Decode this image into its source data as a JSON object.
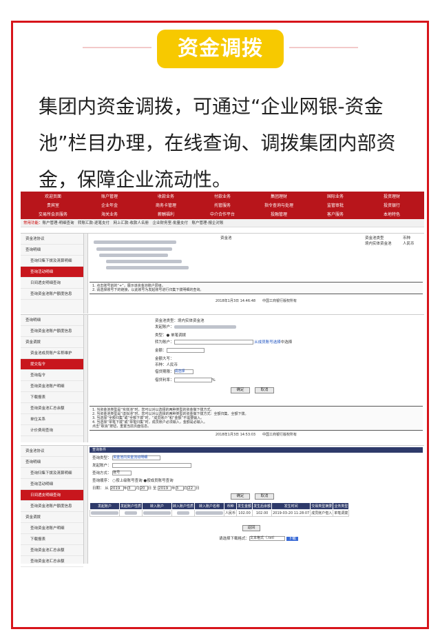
{
  "header": {
    "badge": "资金调拨",
    "intro": "集团内资金调拨，可通过“企业网银-资金池”栏目办理，在线查询、调拨集团内部资金，保障企业流动性。"
  },
  "nav": {
    "items": [
      "欢迎页面",
      "账户管理",
      "收款业务",
      "付款业务",
      "集团理财",
      "国际业务",
      "投资理财",
      "贵宾室",
      "企业年金",
      "商务卡管理",
      "托管服务",
      "指令查询与处理",
      "监管审批",
      "投资银行",
      "交易所会员服务",
      "海关业务",
      "薪酬福利",
      "中介合作平台",
      "投融管理",
      "客户服务",
      "本地特色"
    ]
  },
  "quickbar": {
    "label": "常用功能：",
    "items": "账户管理-明细查询　转账汇款-逐笔支付　网上汇款-收款人名册　企业财务室-批量支付　账户管理-报企对账"
  },
  "panel1": {
    "side": [
      "资金池协议",
      "查询明细",
      "查询归集下拨及清算明细",
      "查询活动明细",
      "日间透支明细查询",
      "查询资金池账户额度信息"
    ],
    "col_head": [
      "资金池",
      "资金池类型",
      "币种"
    ],
    "col_vals": [
      "境内实体资金池",
      "人民币"
    ],
    "notes": [
      "1. 点击账号前的“+”，展示该资金池账户层级。",
      "2. 请选择账号下的链接，以此账号为发起账号进行归集下拨明细的查询。"
    ],
    "footer": "2018年1月3日 14:46:48　　中国工商银行版权所有"
  },
  "panel2": {
    "side": [
      "查询明细",
      "查询资金池账户额度信息",
      "资金调拨",
      "资金池成员账户名称维护",
      "提交指令",
      "查询指令",
      "查询资金池账户明细",
      "下载报表",
      "查询资金池汇总余额",
      "单位关系",
      "计价费用查询"
    ],
    "form": {
      "pool_type_label": "资金池类型：",
      "pool_type": "境内实体资金池",
      "origin_label": "发起账户：",
      "type_label": "类型：",
      "type_opt": "单笔调拨",
      "to_label": "转为账户：",
      "to_link": "从成员账号选择",
      "to_suffix": "中选择",
      "amount_label": "金额：",
      "amount_cn_label": "金额大写：",
      "currency_label": "币种：",
      "currency": "人民币",
      "period_label": "借贷期限：",
      "period": "请选择",
      "rate_label": "借贷利率：",
      "rate_unit": "%",
      "ok": "确定",
      "cancel": "取消"
    },
    "notes": [
      "1. 当资金池类型是“实体池”时，您可以对以选择的两种类型的资金做下拨方式。",
      "2. 当资金池类型是“虚拟池”时，您可以对以选择的两种类型的资金做下拨方式：全额归集、全额下拨。",
      "3. 当选择“全额归集”或“全额下拨”时，“成员账户”和“金额”不需要输入。",
      "4. 当选择“单笔下拨”或“单笔归集”时，成员账户必须输入，金额是必输入。",
      "点击“取消”按钮，重置当前页面信息。"
    ],
    "footer": "2018年1月3日 14:53:03　　中国工商银行版权所有"
  },
  "panel3": {
    "side": [
      "资金池协议",
      "查询明细",
      "查询归集下拨及清算明细",
      "查询活动明细",
      "日间透支明细查询",
      "查询资金池账户额度信息",
      "资金调拨",
      "查询资金池账户明细",
      "下载报表",
      "查询资金池汇总余额",
      "查询资金池汇总余额"
    ],
    "bar": "查询条件",
    "q": {
      "type_label": "查询类型：",
      "type": "资金池内资金流动明细",
      "origin_label": "发起账户：",
      "mode_label": "查询方式：",
      "mode": "账号",
      "seq_label": "查询顺序：",
      "seq1": "按上级账号查询",
      "seq2": "按成员账号查询",
      "date_label": "日期：",
      "from": "从",
      "y1": "2019",
      "m": "年",
      "mo1": "3",
      "mon": "月",
      "d1": "20",
      "day": "日",
      "to": "至",
      "y2": "2019",
      "mo2": "3",
      "d2": "22",
      "ok": "确定",
      "cancel": "取消"
    },
    "th": [
      "发起账户",
      "发起账户性质",
      "转入账户",
      "转入账户性质",
      "转入账户名称",
      "币种",
      "发生金额",
      "发生后余额",
      "发生时间",
      "交易类型摘要",
      "业务类型"
    ],
    "row": [
      "",
      "",
      "",
      "",
      "",
      "人民币",
      "102.00",
      "102.00",
      "2019-03-20 11:28:07",
      "成员账户借入",
      "单笔调拨"
    ],
    "back": "返回",
    "dl_label": "请选择下载格式：",
    "dl": "文本格式（.txt）",
    "dl_btn": "下载"
  }
}
